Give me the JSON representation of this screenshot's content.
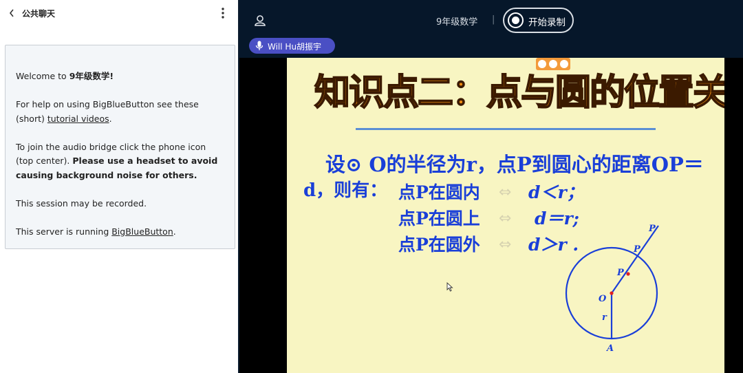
{
  "chat": {
    "title": "公共聊天",
    "back_icon": "chevron-left-icon",
    "more_icon": "vertical-dots-icon",
    "welcome": {
      "line1_prefix": "Welcome to ",
      "line1_name": "9年级数学",
      "line1_suffix": "!",
      "help_prefix": "For help on using BigBlueButton see these (short) ",
      "help_link": "tutorial videos",
      "help_suffix": ".",
      "audio_plain": "To join the audio bridge click the phone icon (top center). ",
      "audio_bold": "Please use a headset to avoid causing background noise for others.",
      "recorded": "This session may be recorded.",
      "server_prefix": "This server is running ",
      "server_link": "BigBlueButton",
      "server_suffix": "."
    }
  },
  "topbar": {
    "user_icon": "user-icon",
    "meeting_title": "9年级数学",
    "separator": "|",
    "record_label": "开始录制",
    "record_icon": "record-icon",
    "talker": "Will Hu胡振宇",
    "mic_icon": "microphone-icon"
  },
  "slide": {
    "title": "知识点二：点与圆的位置关系",
    "line1": "设⊙ O的半径为r，点P到圆心的距离OP＝",
    "line2": "d，则有：",
    "conditions": [
      "点P在圆内",
      "点P在圆上",
      "点P在圆外"
    ],
    "arrow": "⇔",
    "relations": [
      "d＜r；",
      "d＝r;",
      "d＞r ."
    ],
    "figure_labels": {
      "p_outer": "P",
      "p_on": "P",
      "p_inner": "P",
      "o": "O",
      "r": "r",
      "a": "A"
    }
  },
  "colors": {
    "topbar_bg": "#06172a",
    "talker_bg": "#4a4fc4",
    "slide_bg": "#f8f5c2",
    "slide_text": "#1a3fd8",
    "slide_title": "#ed8a12"
  }
}
